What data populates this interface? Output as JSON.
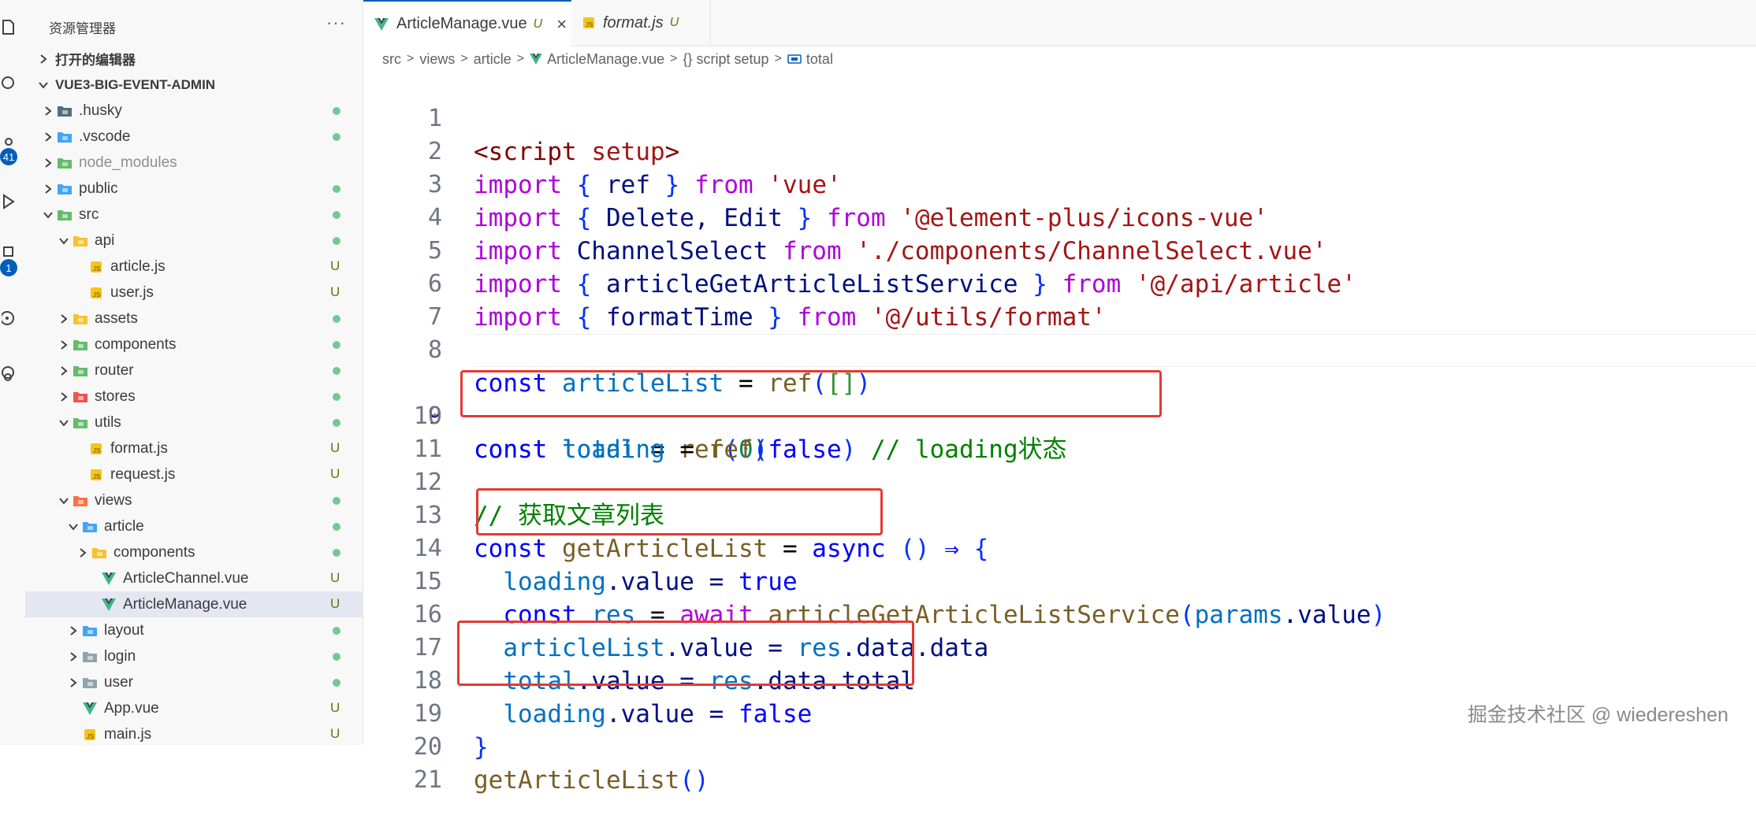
{
  "activity_bar": {
    "badges": [
      "41",
      "1"
    ],
    "icons": [
      "files-icon",
      "search-icon",
      "source-control-icon",
      "run-debug-icon",
      "extensions-icon",
      "remote-icon",
      "timeline-icon"
    ]
  },
  "sidebar": {
    "title": "资源管理器",
    "more": "···",
    "open_editors_label": "打开的编辑器",
    "project_label": "VUE3-BIG-EVENT-ADMIN",
    "tree": [
      {
        "label": ".husky",
        "status": "dot"
      },
      {
        "label": ".vscode",
        "status": "dot"
      },
      {
        "label": "node_modules",
        "status": ""
      },
      {
        "label": "public",
        "status": "dot"
      },
      {
        "label": "src",
        "status": "dot"
      },
      {
        "label": "api",
        "status": "dot"
      },
      {
        "label": "article.js",
        "status": "U"
      },
      {
        "label": "user.js",
        "status": "U"
      },
      {
        "label": "assets",
        "status": "dot"
      },
      {
        "label": "components",
        "status": "dot"
      },
      {
        "label": "router",
        "status": "dot"
      },
      {
        "label": "stores",
        "status": "dot"
      },
      {
        "label": "utils",
        "status": "dot"
      },
      {
        "label": "format.js",
        "status": "U"
      },
      {
        "label": "request.js",
        "status": "U"
      },
      {
        "label": "views",
        "status": "dot"
      },
      {
        "label": "article",
        "status": "dot"
      },
      {
        "label": "components",
        "status": "dot"
      },
      {
        "label": "ArticleChannel.vue",
        "status": "U"
      },
      {
        "label": "ArticleManage.vue",
        "status": "U"
      },
      {
        "label": "layout",
        "status": "dot"
      },
      {
        "label": "login",
        "status": "dot"
      },
      {
        "label": "user",
        "status": "dot"
      },
      {
        "label": "App.vue",
        "status": "U"
      },
      {
        "label": "main.js",
        "status": "U"
      }
    ]
  },
  "tabs": [
    {
      "label": "ArticleManage.vue",
      "status": "U",
      "close": "×"
    },
    {
      "label": "format.js",
      "status": "U"
    }
  ],
  "breadcrumb": [
    "src",
    "views",
    "article",
    "ArticleManage.vue",
    "{} script setup",
    "total"
  ],
  "breadcrumb_sep": ">",
  "code": {
    "line_numbers": [
      "1",
      "2",
      "3",
      "4",
      "5",
      "6",
      "7",
      "8",
      "9",
      "10",
      "11",
      "12",
      "13",
      "14",
      "15",
      "16",
      "17",
      "18",
      "19",
      "20",
      "21"
    ],
    "l1": [
      "<",
      "script",
      " ",
      "setup",
      ">"
    ],
    "l2": [
      "import",
      " ",
      "{",
      " ref ",
      "}",
      " ",
      "from",
      " ",
      "'vue'"
    ],
    "l3": [
      "import",
      " ",
      "{",
      " Delete, Edit ",
      "}",
      " ",
      "from",
      " ",
      "'@element-plus/icons-vue'"
    ],
    "l4": [
      "import",
      " ChannelSelect ",
      "from",
      " ",
      "'./components/ChannelSelect.vue'"
    ],
    "l5": [
      "import",
      " ",
      "{",
      " articleGetArticleListService ",
      "}",
      " ",
      "from",
      " ",
      "'@/api/article'"
    ],
    "l6": [
      "import",
      " ",
      "{",
      " formatTime ",
      "}",
      " ",
      "from",
      " ",
      "'@/utils/format'"
    ],
    "l8": [
      "const",
      " ",
      "articleList",
      " = ",
      "ref",
      "(",
      "[]",
      ")"
    ],
    "l9": [
      "const",
      " ",
      "total",
      " = ",
      "ref",
      "(",
      "0",
      ")"
    ],
    "l10": [
      "const",
      " ",
      "loading",
      " = ",
      "ref",
      "(",
      "false",
      ")",
      " // loading状态"
    ],
    "l12": [
      "// 获取文章列表"
    ],
    "l13": [
      "const",
      " ",
      "getArticleList",
      " = ",
      "async",
      " ",
      "()",
      " ",
      "⇒",
      " ",
      "{"
    ],
    "l14": [
      "  ",
      "loading",
      ".value = ",
      "true"
    ],
    "l15": [
      "  ",
      "const",
      " ",
      "res",
      " = ",
      "await",
      " ",
      "articleGetArticleListService",
      "(",
      "params",
      ".value",
      ")"
    ],
    "l16": [
      "  ",
      "articleList",
      ".value = ",
      "res",
      ".",
      "data",
      ".",
      "data"
    ],
    "l17": [
      "  ",
      "total",
      ".value = ",
      "res",
      ".",
      "data",
      ".",
      "total"
    ],
    "l18": [
      "  ",
      "loading",
      ".value = ",
      "false"
    ],
    "l19": [
      "}"
    ],
    "l20": [
      "getArticleList",
      "()"
    ]
  },
  "watermark": "掘金技术社区 @ wiedereshen",
  "colors": {
    "highlight_box": "#e53935",
    "accent": "#005fb8"
  }
}
